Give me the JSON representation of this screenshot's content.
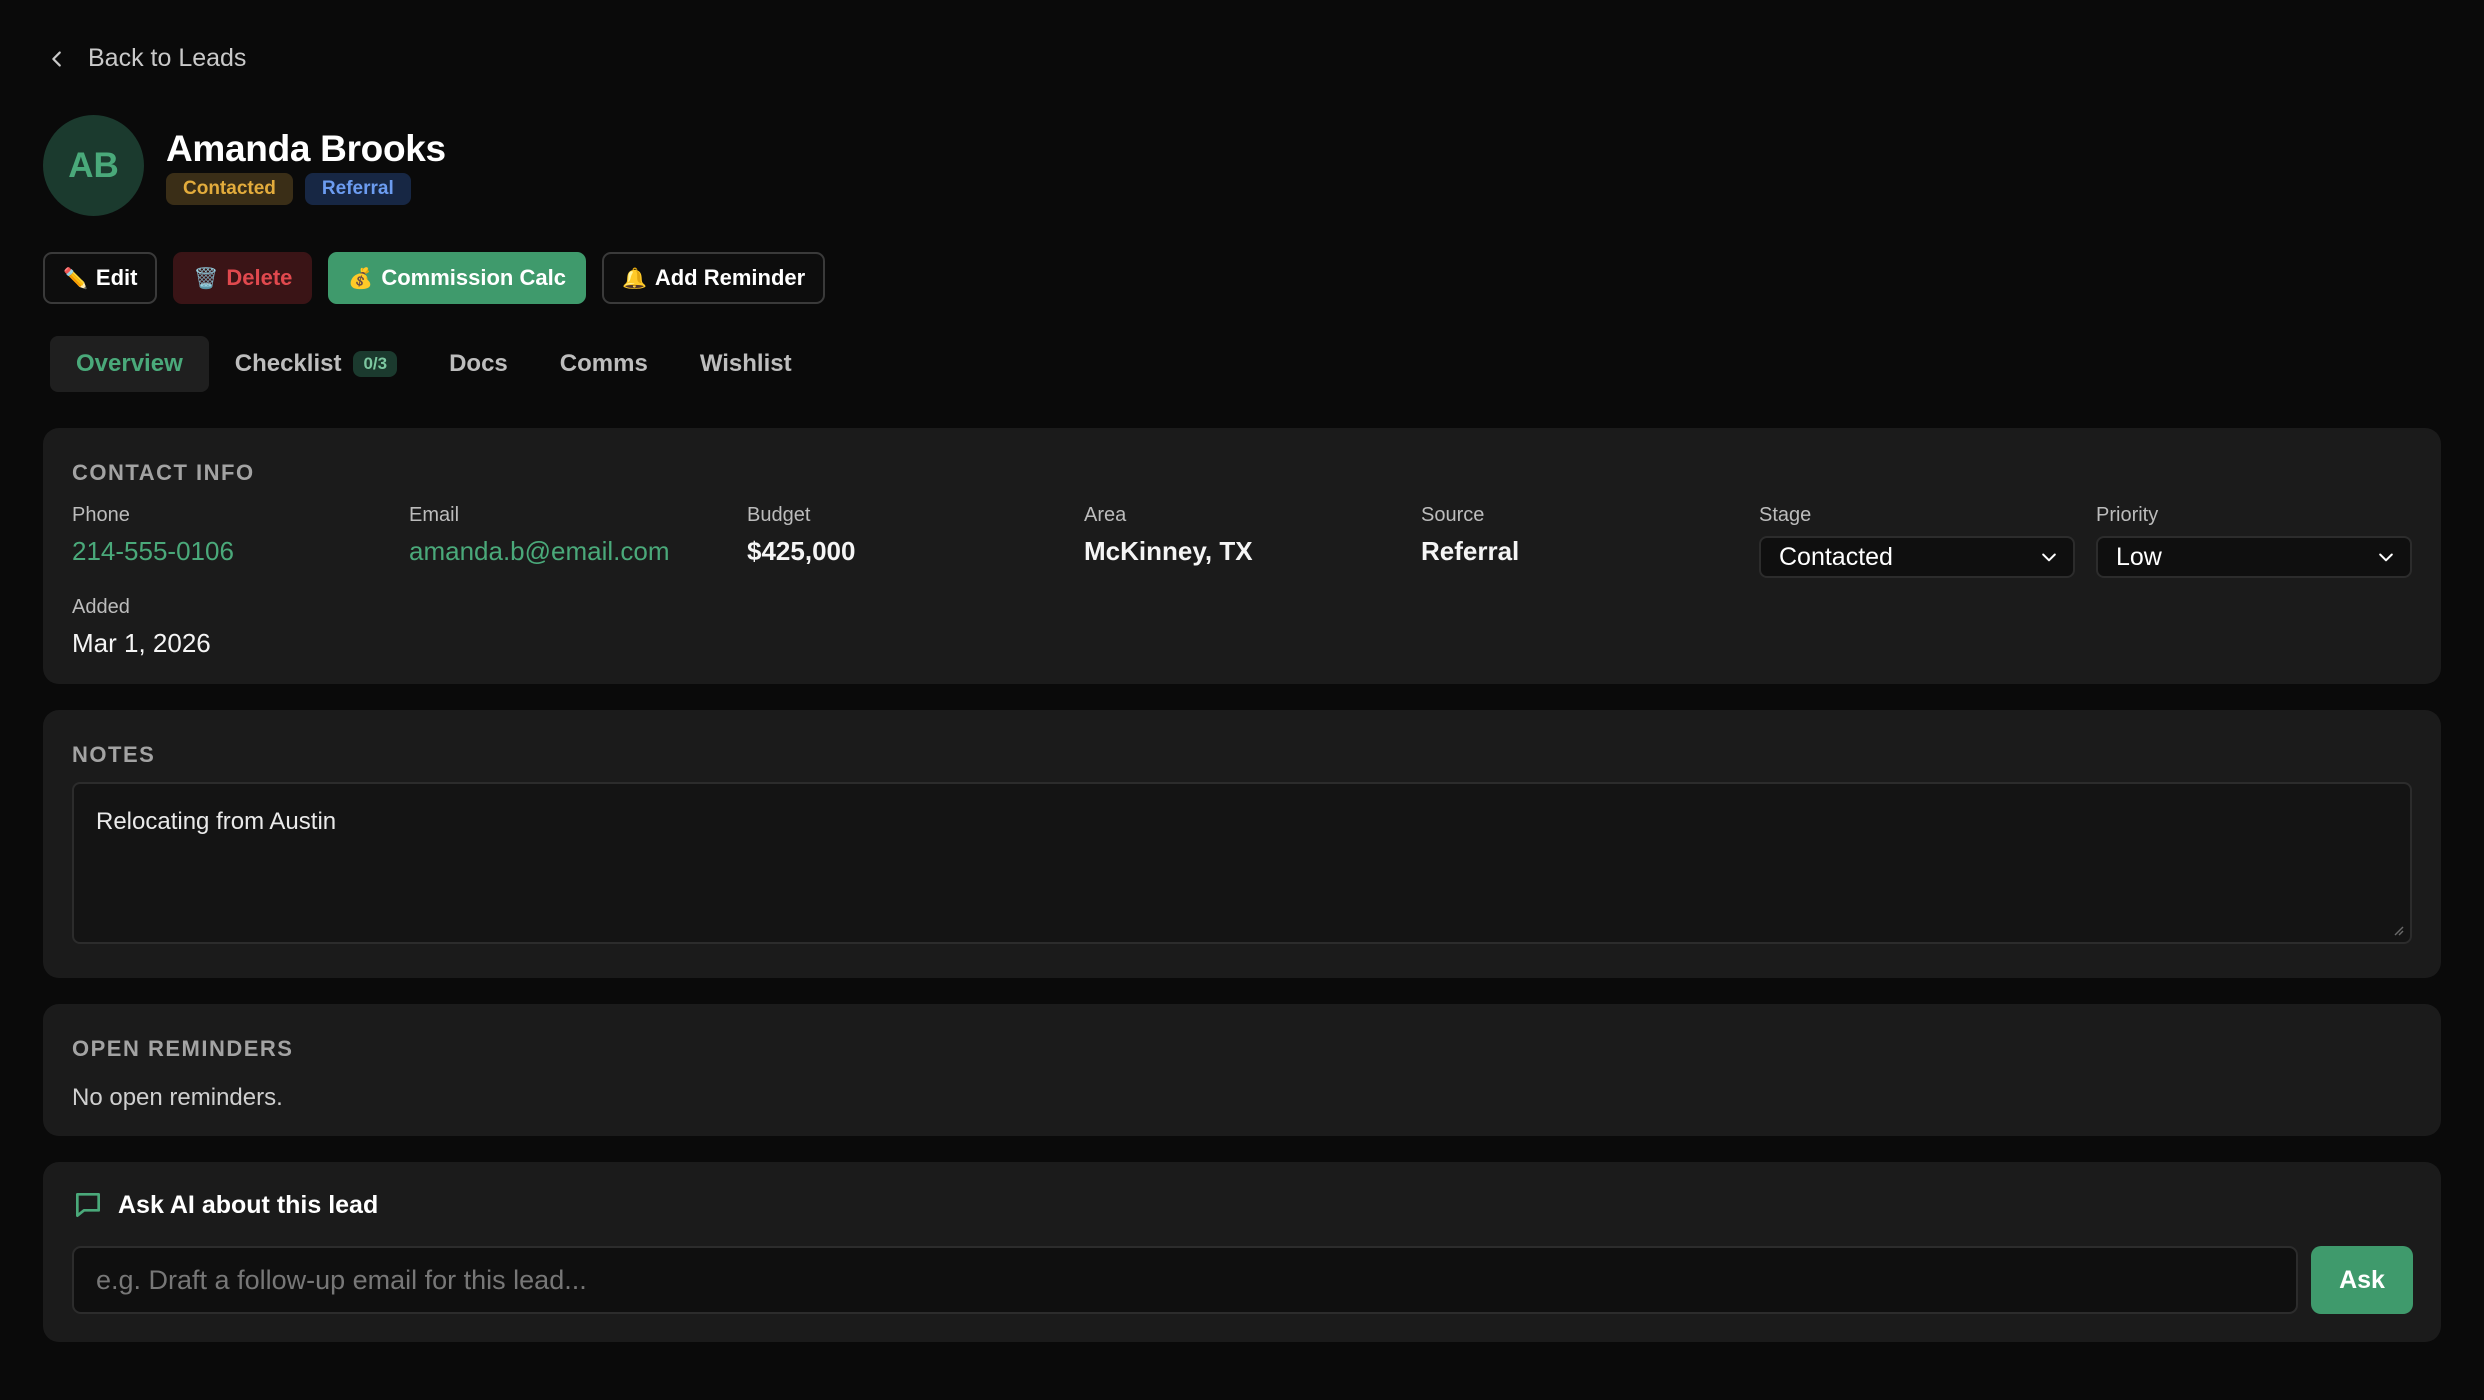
{
  "nav": {
    "back_label": "Back to Leads"
  },
  "lead": {
    "initials": "AB",
    "name": "Amanda Brooks",
    "stage_badge": "Contacted",
    "source_badge": "Referral"
  },
  "actions": {
    "edit": {
      "icon": "✏️",
      "label": "Edit"
    },
    "delete": {
      "icon": "🗑️",
      "label": "Delete"
    },
    "commission": {
      "icon": "💰",
      "label": "Commission Calc"
    },
    "reminder": {
      "icon": "🔔",
      "label": "Add Reminder"
    }
  },
  "tabs": [
    {
      "label": "Overview",
      "active": true
    },
    {
      "label": "Checklist",
      "count": "0/3"
    },
    {
      "label": "Docs"
    },
    {
      "label": "Comms"
    },
    {
      "label": "Wishlist"
    }
  ],
  "contact": {
    "title": "CONTACT INFO",
    "phone": {
      "label": "Phone",
      "value": "214-555-0106"
    },
    "email": {
      "label": "Email",
      "value": "amanda.b@email.com"
    },
    "budget": {
      "label": "Budget",
      "value": "$425,000"
    },
    "area": {
      "label": "Area",
      "value": "McKinney, TX"
    },
    "source": {
      "label": "Source",
      "value": "Referral"
    },
    "stage": {
      "label": "Stage",
      "value": "Contacted"
    },
    "priority": {
      "label": "Priority",
      "value": "Low"
    },
    "added": {
      "label": "Added",
      "value": "Mar 1, 2026"
    }
  },
  "notes": {
    "title": "NOTES",
    "text": "Relocating from Austin"
  },
  "reminders": {
    "title": "OPEN REMINDERS",
    "empty_text": "No open reminders."
  },
  "ai": {
    "title": "Ask AI about this lead",
    "placeholder": "e.g. Draft a follow-up email for this lead...",
    "button_label": "Ask"
  },
  "colors": {
    "accent": "#3f9a6c",
    "accent_text": "#4aa97a",
    "danger": "#e0494e",
    "warning": "#e3ac3c",
    "info": "#6c9cf0",
    "background": "#0a0a0a",
    "card": "#1b1b1b"
  }
}
